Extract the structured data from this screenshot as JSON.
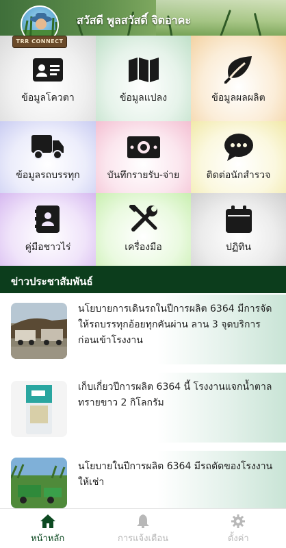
{
  "header": {
    "greeting": "สวัสดี พูลสวัสดิ์ จิตอาคะ",
    "logo_text": "TRR CONNECT"
  },
  "menu": [
    {
      "label": "ข้อมูลโควตา",
      "icon": "id-card-icon"
    },
    {
      "label": "ข้อมูลแปลง",
      "icon": "map-icon"
    },
    {
      "label": "ข้อมูลผลผลิต",
      "icon": "leaf-icon"
    },
    {
      "label": "ข้อมูลรถบรรทุก",
      "icon": "truck-icon"
    },
    {
      "label": "บันทึกรายรับ-จ่าย",
      "icon": "money-bill-icon"
    },
    {
      "label": "ติดต่อนักสำรวจ",
      "icon": "chat-icon"
    },
    {
      "label": "คู่มือชาวไร่",
      "icon": "address-book-icon"
    },
    {
      "label": "เครื่องมือ",
      "icon": "tools-icon"
    },
    {
      "label": "ปฏิทิน",
      "icon": "calendar-icon"
    }
  ],
  "news": {
    "title": "ข่าวประชาสัมพันธ์",
    "items": [
      {
        "text": "นโยบายการเดินรถในปีการผลิต 6364 มีการจัดให้รถบรรทุกอ้อยทุกคันผ่าน ลาน 3 จุดบริการ ก่อนเข้าโรงงาน",
        "thumb": "sugarcane-trucks-photo"
      },
      {
        "text": "เก็บเกี่ยวปีการผลิต 6364 นี้ โรงงานแจกน้ำตาลทรายขาว 2 กิโลกรัม",
        "thumb": "sugar-bag-photo"
      },
      {
        "text": "นโยบายในปีการผลิต 6364 มีรถตัดของโรงงานให้เช่า",
        "thumb": "harvester-photo"
      }
    ]
  },
  "bottom_nav": [
    {
      "label": "หน้าหลัก",
      "icon": "home-icon",
      "active": true
    },
    {
      "label": "การแจ้งเตือน",
      "icon": "bell-icon",
      "active": false
    },
    {
      "label": "ตั้งค่า",
      "icon": "gear-icon",
      "active": false
    }
  ],
  "colors": {
    "primary_dark_green": "#0c3d1c",
    "nav_active": "#0d4a22",
    "nav_inactive": "#b8b8b8",
    "icon": "#1a1a1a"
  }
}
